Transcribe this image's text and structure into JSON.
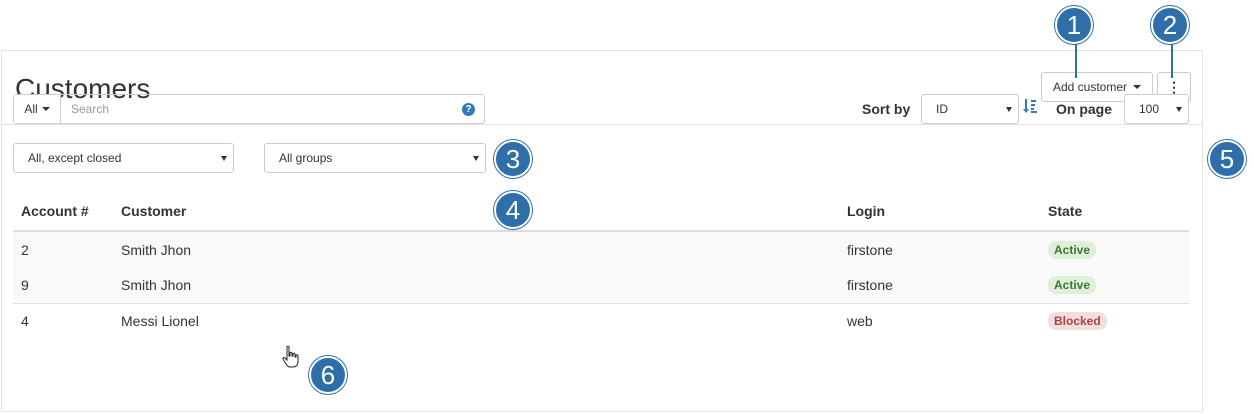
{
  "header": {
    "title": "Customers",
    "add_customer_label": "Add customer",
    "more_label": "⋮"
  },
  "search": {
    "scope_label": "All",
    "placeholder": "Search",
    "help_label": "?"
  },
  "filters": {
    "status_selected": "All, except closed",
    "group_selected": "All groups"
  },
  "sorting": {
    "sort_label": "Sort by",
    "sort_selected": "ID",
    "page_label": "On page",
    "page_selected": "100"
  },
  "table": {
    "columns": [
      "Account #",
      "Customer",
      "Login",
      "State"
    ],
    "rows": [
      {
        "account": "2",
        "customer": "Smith Jhon",
        "login": "firstone",
        "state": "Active"
      },
      {
        "account": "9",
        "customer": "Smith Jhon",
        "login": "firstone",
        "state": "Active"
      },
      {
        "account": "4",
        "customer": "Messi Lionel",
        "login": "web",
        "state": "Blocked"
      }
    ]
  },
  "callouts": [
    "1",
    "2",
    "3",
    "4",
    "5",
    "6"
  ],
  "colors": {
    "accent": "#2f6fa9",
    "active_bg": "#dff0d8",
    "active_text": "#3c763d",
    "blocked_bg": "#f2dede",
    "blocked_text": "#a94442"
  }
}
